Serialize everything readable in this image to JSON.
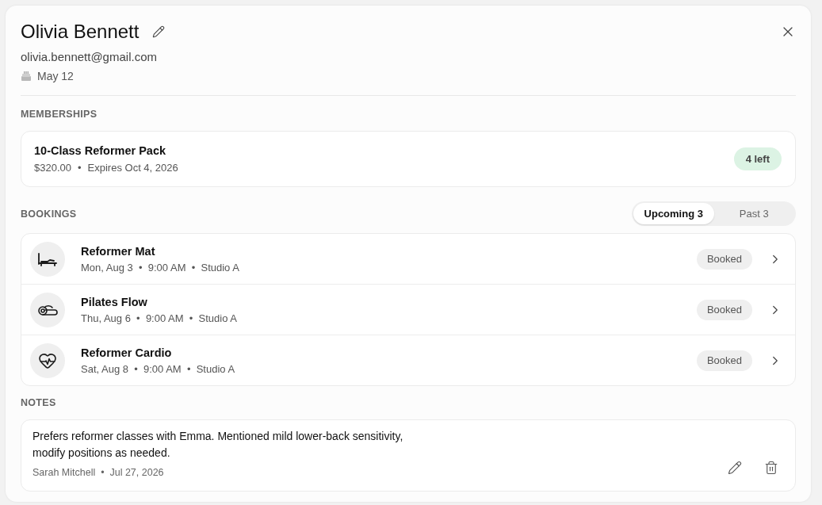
{
  "profile": {
    "name": "Olivia Bennett",
    "email": "olivia.bennett@gmail.com",
    "birthday": "May 12"
  },
  "memberships": {
    "heading": "MEMBERSHIPS",
    "items": [
      {
        "title": "10-Class Reformer Pack",
        "price": "$320.00",
        "separator": "•",
        "expires": "Expires Oct 4, 2026",
        "badge": "4 left"
      }
    ]
  },
  "bookings": {
    "heading": "BOOKINGS",
    "tabs": [
      {
        "label": "Upcoming 3",
        "selected": true
      },
      {
        "label": "Past 3",
        "selected": false
      }
    ],
    "items": [
      {
        "kind": "reformer",
        "title": "Reformer Mat",
        "details": "Mon, Aug 3  •  9:00 AM  •  Studio A",
        "status": "Booked"
      },
      {
        "kind": "mat",
        "title": "Pilates Flow",
        "details": "Thu, Aug 6  •  9:00 AM  •  Studio A",
        "status": "Booked"
      },
      {
        "kind": "cardio",
        "title": "Reformer Cardio",
        "details": "Sat, Aug 8  •  9:00 AM  •  Studio A",
        "status": "Booked"
      }
    ]
  },
  "notes": {
    "heading": "NOTES",
    "items": [
      {
        "text": "Prefers reformer classes with Emma. Mentioned mild lower-back sensitivity, modify positions as needed.",
        "byline": "Sarah Mitchell  •  Jul 27, 2026"
      }
    ]
  }
}
